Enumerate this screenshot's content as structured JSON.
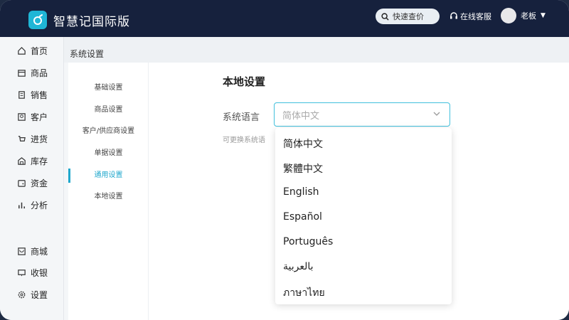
{
  "app": {
    "title": "智慧记国际版"
  },
  "header": {
    "search_label": "快速查价",
    "service_label": "在线客服",
    "user_name": "老板"
  },
  "sidebar": {
    "items": [
      {
        "label": "首页",
        "icon": "home-icon"
      },
      {
        "label": "商品",
        "icon": "box-icon"
      },
      {
        "label": "销售",
        "icon": "receipt-icon"
      },
      {
        "label": "客户",
        "icon": "person-icon"
      },
      {
        "label": "进货",
        "icon": "cart-icon"
      },
      {
        "label": "库存",
        "icon": "warehouse-icon"
      },
      {
        "label": "资金",
        "icon": "wallet-icon"
      },
      {
        "label": "分析",
        "icon": "chart-icon"
      }
    ],
    "bottom_items": [
      {
        "label": "商城",
        "icon": "store-icon"
      },
      {
        "label": "收银",
        "icon": "register-icon"
      },
      {
        "label": "设置",
        "icon": "gear-icon"
      }
    ]
  },
  "breadcrumb": "系统设置",
  "settings_nav": [
    "基础设置",
    "商品设置",
    "客户/供应商设置",
    "单据设置",
    "通用设置",
    "本地设置"
  ],
  "active_settings_nav": "通用设置",
  "section_title": "本地设置",
  "language_field": {
    "label": "系统语言",
    "placeholder": "简体中文",
    "hint": "可更换系统语"
  },
  "language_options": [
    "简体中文",
    "繁體中文",
    "English",
    "Español",
    "Português",
    "بالعربية",
    "ภาษาไทย"
  ],
  "colors": {
    "topbar": "#16213d",
    "accent": "#1fa7cc"
  }
}
